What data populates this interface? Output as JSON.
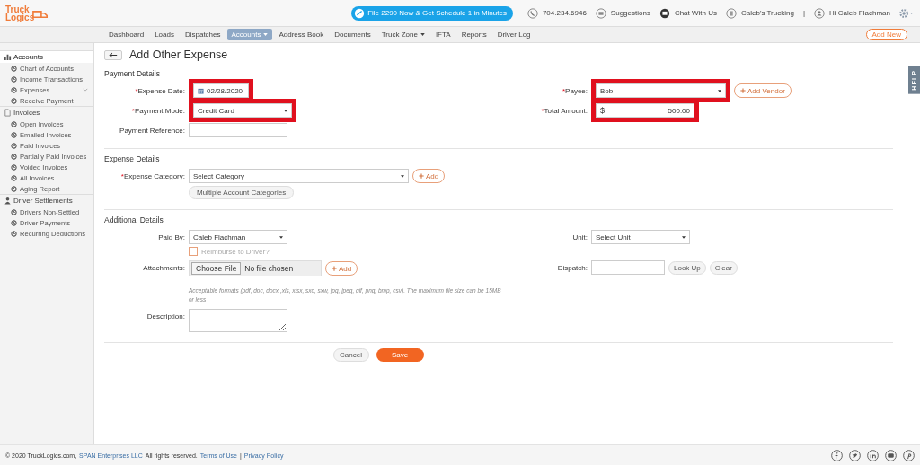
{
  "logo": {
    "line1": "Truck",
    "line2": "Logics"
  },
  "promo": "File 2290 Now & Get Schedule 1 in Minutes",
  "header_links": [
    {
      "kind": "phone",
      "label": "704.234.6946"
    },
    {
      "kind": "mail",
      "label": "Suggestions"
    },
    {
      "kind": "chat",
      "label": "Chat With Us"
    },
    {
      "kind": "company",
      "label": "Caleb's Trucking"
    },
    {
      "kind": "separator",
      "label": "|"
    },
    {
      "kind": "user",
      "label": "Hi Caleb Flachman"
    }
  ],
  "nav": {
    "items": [
      {
        "label": "Dashboard",
        "selected": false,
        "dropdown": false
      },
      {
        "label": "Loads",
        "selected": false,
        "dropdown": false
      },
      {
        "label": "Dispatches",
        "selected": false,
        "dropdown": false
      },
      {
        "label": "Accounts",
        "selected": true,
        "dropdown": true
      },
      {
        "label": "Address Book",
        "selected": false,
        "dropdown": false
      },
      {
        "label": "Documents",
        "selected": false,
        "dropdown": false
      },
      {
        "label": "Truck Zone",
        "selected": false,
        "dropdown": true
      },
      {
        "label": "IFTA",
        "selected": false,
        "dropdown": false
      },
      {
        "label": "Reports",
        "selected": false,
        "dropdown": false
      },
      {
        "label": "Driver Log",
        "selected": false,
        "dropdown": false
      }
    ],
    "add_new": "Add New"
  },
  "sidebar": {
    "sections": [
      {
        "title": "Accounts",
        "selected": true,
        "items": [
          {
            "label": "Chart of Accounts",
            "expandable": false
          },
          {
            "label": "Income Transactions",
            "expandable": false
          },
          {
            "label": "Expenses",
            "expandable": true
          },
          {
            "label": "Receive Payment",
            "expandable": false
          }
        ]
      },
      {
        "title": "Invoices",
        "selected": false,
        "items": [
          {
            "label": "Open Invoices",
            "expandable": false
          },
          {
            "label": "Emailed Invoices",
            "expandable": false
          },
          {
            "label": "Paid Invoices",
            "expandable": false
          },
          {
            "label": "Partially Paid Invoices",
            "expandable": false
          },
          {
            "label": "Voided Invoices",
            "expandable": false
          },
          {
            "label": "All Invoices",
            "expandable": false
          },
          {
            "label": "Aging Report",
            "expandable": false
          }
        ]
      },
      {
        "title": "Driver Settlements",
        "selected": false,
        "items": [
          {
            "label": "Drivers Non-Settled",
            "expandable": false
          },
          {
            "label": "Driver Payments",
            "expandable": false
          },
          {
            "label": "Recurring Deductions",
            "expandable": false
          }
        ]
      }
    ]
  },
  "page_title": "Add Other Expense",
  "help_tab": "HELP",
  "sections": [
    {
      "title": "Payment Details",
      "rows": [
        {
          "left": {
            "mark": "*",
            "label": "Expense Date:",
            "kind": "date",
            "value": "02/28/2020",
            "highlighted": true
          },
          "right": {
            "mark": "*",
            "label": "Payee:",
            "kind": "select",
            "value": "Bob",
            "highlighted": true,
            "add_button": "Add Vendor"
          }
        },
        {
          "left": {
            "mark": "*",
            "label": "Payment Mode:",
            "kind": "select",
            "value": "Credit Card",
            "highlighted": true
          },
          "right": {
            "mark": "*",
            "label": "Total Amount:",
            "kind": "amount",
            "currency": "$",
            "value": "500.00",
            "highlighted": true
          }
        },
        {
          "left": {
            "label": "Payment Reference:",
            "kind": "text",
            "highlighted": false
          }
        }
      ]
    },
    {
      "title": "Expense Details",
      "rows": [
        {
          "left": {
            "mark": "*",
            "label": "Expense Category:",
            "kind": "select",
            "value": "Select Category",
            "highlighted": false,
            "add_button": "Add",
            "below_button": "Multiple Account Categories"
          }
        }
      ]
    },
    {
      "title": "Additional Details",
      "rows": [
        {
          "left": {
            "label": "Paid By:",
            "kind": "select",
            "value": "Caleb Flachman",
            "highlighted": false,
            "checkbox": {
              "label": "Reimburse to Driver?",
              "checked": false,
              "disabled": true
            }
          },
          "right": {
            "label": "Unit:",
            "kind": "select",
            "value": "Select Unit",
            "highlighted": false
          }
        },
        {
          "left": {
            "label": "Attachments:",
            "kind": "file",
            "button": "Choose File",
            "value": "No file chosen",
            "highlighted": false,
            "add_button": "Add",
            "hint": "Acceptable formats (pdf, doc, docx ,xls, xlsx, sxc, sxw, jpg, jpeg, gif, png, bmp, csv). The maximum file size can be 15MB or less"
          },
          "right": {
            "label": "Dispatch:",
            "kind": "text",
            "highlighted": false,
            "buttons": [
              "Look Up",
              "Clear"
            ]
          }
        },
        {
          "left": {
            "label": "Description:",
            "kind": "textarea",
            "highlighted": false
          }
        }
      ]
    }
  ],
  "actions": {
    "cancel": "Cancel",
    "save": "Save"
  },
  "footer": {
    "copyright": "© 2020 TruckLogics.com,",
    "company_link": "SPAN Enterprises LLC",
    "rights": "All rights reserved.",
    "terms": "Terms of Use",
    "separator": "|",
    "privacy": "Privacy Policy"
  }
}
